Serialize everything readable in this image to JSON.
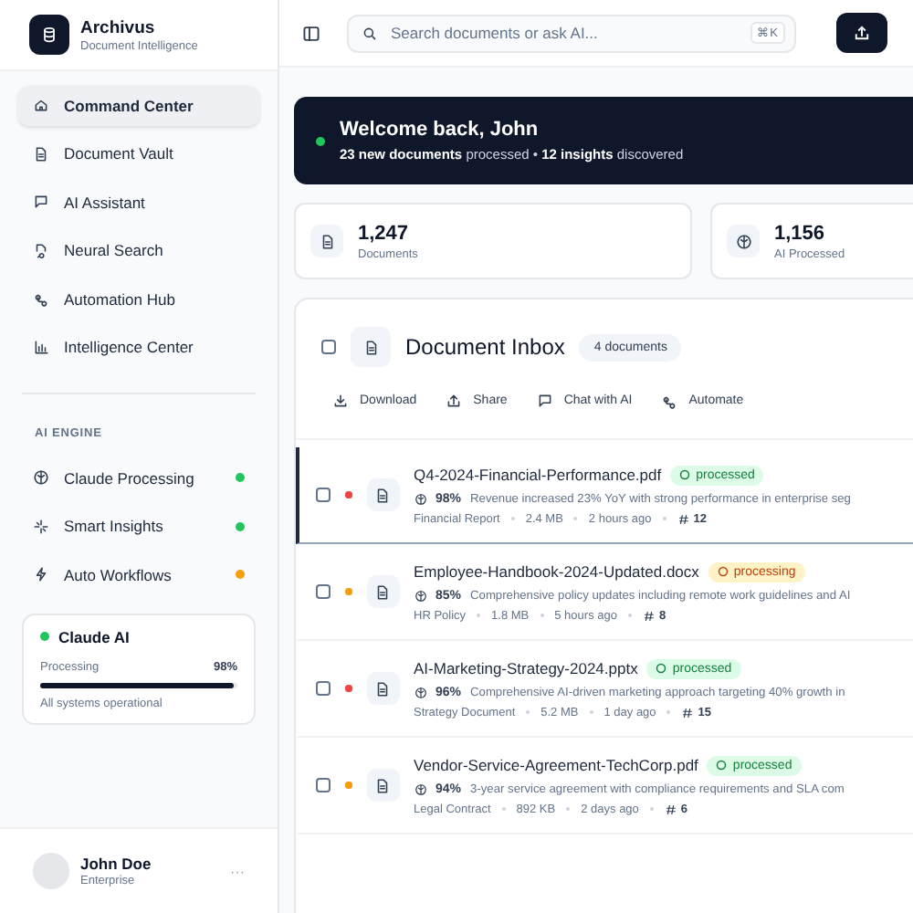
{
  "brand": {
    "name": "Archivus",
    "tagline": "Document Intelligence"
  },
  "nav": [
    {
      "label": "Command Center",
      "selected": true
    },
    {
      "label": "Document Vault",
      "selected": false
    },
    {
      "label": "AI Assistant",
      "selected": false
    },
    {
      "label": "Neural Search",
      "selected": false
    },
    {
      "label": "Automation Hub",
      "selected": false
    },
    {
      "label": "Intelligence Center",
      "selected": false
    }
  ],
  "engine": {
    "heading": "AI ENGINE",
    "items": [
      {
        "label": "Claude Processing",
        "color": "#22c55e"
      },
      {
        "label": "Smart Insights",
        "color": "#22c55e"
      },
      {
        "label": "Auto Workflows",
        "color": "#f59e0b"
      }
    ]
  },
  "ai_card": {
    "title": "Claude AI",
    "status_label": "Processing",
    "reading": "98%",
    "level": 0.98,
    "note": "All systems operational"
  },
  "user": {
    "name": "John Doe",
    "plan": "Enterprise",
    "menu": "···"
  },
  "search": {
    "placeholder": "Search documents or ask AI...",
    "shortcut": "⌘K"
  },
  "welcome": {
    "title": "Welcome back, John",
    "subtitle": "**23 new documents** processed • **12 insights** discovered"
  },
  "stats": [
    {
      "value": "1,247",
      "label": "Documents"
    },
    {
      "value": "1,156",
      "label": "AI Processed"
    }
  ],
  "inbox": {
    "title": "Document Inbox",
    "count": "4 documents",
    "checked": false,
    "actions": [
      {
        "label": "Download"
      },
      {
        "label": "Share"
      },
      {
        "label": "Chat with AI"
      },
      {
        "label": "Automate"
      }
    ],
    "rows": [
      {
        "name": "Q4-2024-Financial-Performance.pdf",
        "status": "processed",
        "kind": "processed",
        "confidence": "98%",
        "summary": "Revenue increased 23% YoY with strong performance in enterprise seg",
        "category": "Financial Report",
        "size": "2.4 MB",
        "time": "2 hours ago",
        "tags": "12",
        "color": "#ef4444",
        "selected": true,
        "checked": false
      },
      {
        "name": "Employee-Handbook-2024-Updated.docx",
        "status": "processing",
        "kind": "processing",
        "confidence": "85%",
        "summary": "Comprehensive policy updates including remote work guidelines and AI",
        "category": "HR Policy",
        "size": "1.8 MB",
        "time": "5 hours ago",
        "tags": "8",
        "color": "#f59e0b",
        "selected": false,
        "checked": false
      },
      {
        "name": "AI-Marketing-Strategy-2024.pptx",
        "status": "processed",
        "kind": "processed",
        "confidence": "96%",
        "summary": "Comprehensive AI-driven marketing approach targeting 40% growth in",
        "category": "Strategy Document",
        "size": "5.2 MB",
        "time": "1 day ago",
        "tags": "15",
        "color": "#ef4444",
        "selected": false,
        "checked": false
      },
      {
        "name": "Vendor-Service-Agreement-TechCorp.pdf",
        "status": "processed",
        "kind": "processed",
        "confidence": "94%",
        "summary": "3-year service agreement with compliance requirements and SLA com",
        "category": "Legal Contract",
        "size": "892 KB",
        "time": "2 days ago",
        "tags": "6",
        "color": "#f59e0b",
        "selected": false,
        "checked": false
      }
    ]
  }
}
